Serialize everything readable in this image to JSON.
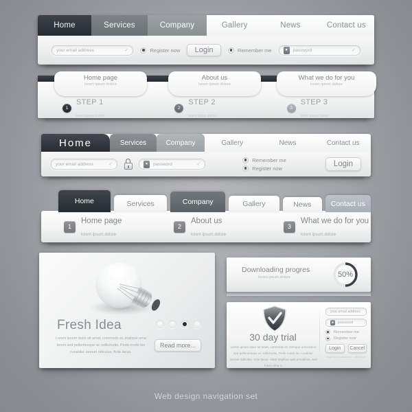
{
  "caption": "Web design navigation set",
  "nav_bar_1": {
    "tabs": [
      {
        "label": "Home",
        "state": "active-dark"
      },
      {
        "label": "Services",
        "state": "mid"
      },
      {
        "label": "Company",
        "state": "mid2"
      },
      {
        "label": "Gallery",
        "state": "light"
      },
      {
        "label": "News",
        "state": "light"
      },
      {
        "label": "Contact us",
        "state": "light"
      }
    ],
    "email_placeholder": "your email address",
    "password_placeholder": "password",
    "register_label": "Register now",
    "remember_label": "Remember me",
    "login_label": "Login",
    "check_glyph": "✓",
    "lock_glyph": "A"
  },
  "steps_bar": {
    "cards": [
      {
        "title": "Home page",
        "subtitle": "lorem ipsum dolore"
      },
      {
        "title": "About us",
        "subtitle": "lorem ipsum dolore"
      },
      {
        "title": "What we do for you",
        "subtitle": "lorem ipsum dolore"
      }
    ],
    "steps": [
      {
        "num": "1",
        "label": "STEP 1",
        "sub": "lorem ipsum dolore"
      },
      {
        "num": "2",
        "label": "STEP 2",
        "sub": "lorem ipsum dolore"
      },
      {
        "num": "3",
        "label": "STEP 3",
        "sub": "lorem ipsum dolore"
      }
    ]
  },
  "nav_bar_3": {
    "tabs": [
      {
        "label": "Home",
        "state": "active-dark"
      },
      {
        "label": "Services",
        "state": "mid"
      },
      {
        "label": "Company",
        "state": "mid2"
      },
      {
        "label": "Gallery",
        "state": "light"
      },
      {
        "label": "News",
        "state": "light"
      },
      {
        "label": "Contact us",
        "state": "light"
      }
    ],
    "email_placeholder": "your email address",
    "password_placeholder": "password",
    "remember_label": "Remember me",
    "register_label": "Register now",
    "login_label": "Login"
  },
  "nav_bar_4": {
    "tabs": [
      {
        "label": "Home",
        "state": "active-dark"
      },
      {
        "label": "Services",
        "state": "light"
      },
      {
        "label": "Company",
        "state": "dark-grey"
      },
      {
        "label": "Gallery",
        "state": "light"
      },
      {
        "label": "News",
        "state": "light"
      },
      {
        "label": "Contact us",
        "state": "blue-grey"
      }
    ],
    "items": [
      {
        "num": "1",
        "title": "Home page",
        "subtitle": "lorem ipsum dolore"
      },
      {
        "num": "2",
        "title": "About us",
        "subtitle": "lorem ipsum dolore"
      },
      {
        "num": "3",
        "title": "What we do for you",
        "subtitle": "lorem ipsum dolore"
      }
    ]
  },
  "fresh_idea": {
    "title": "Fresh Idea",
    "paragraph": "Lorem ipsum dolor sit amet, commodo et, tristique urna lorem sed pellentesque ac sollicitudin. Pede morbi leo curabitur laoreet ridiculus. Ante lacus.",
    "read_more_label": "Read more...",
    "dots_total": 4,
    "dots_active_index": 2
  },
  "progress_panel": {
    "title": "Downloading progres",
    "subtitle": "lorem ipsum dolore",
    "percent_label": "50%",
    "percent_value": 50
  },
  "trial_panel": {
    "title": "30 day trial",
    "paragraph": "Lorem ipsum dolor sit amet, commodo et, tristique urna lorem sed pellentesque ac sollicitudin. Pede morbi leo curabitur laoreet ridiculus. Ante lacus. Vitae dapibus quis penatibus, sed fusce urna in",
    "email_placeholder": "your email address",
    "password_placeholder": "password",
    "remember_label": "Remember me",
    "register_label": "Register now",
    "login_label": "Login",
    "cancel_label": "Cancel",
    "forgot_label": "forgot your password? - click here"
  },
  "colors": {
    "background": "#a2a5a9",
    "dark_tab": "#2b3035",
    "mid_tab": "#747a7e",
    "light_tab": "#f7f8f8",
    "blue_grey_tab": "#b2b8c0",
    "text_grey": "#858a8e"
  }
}
